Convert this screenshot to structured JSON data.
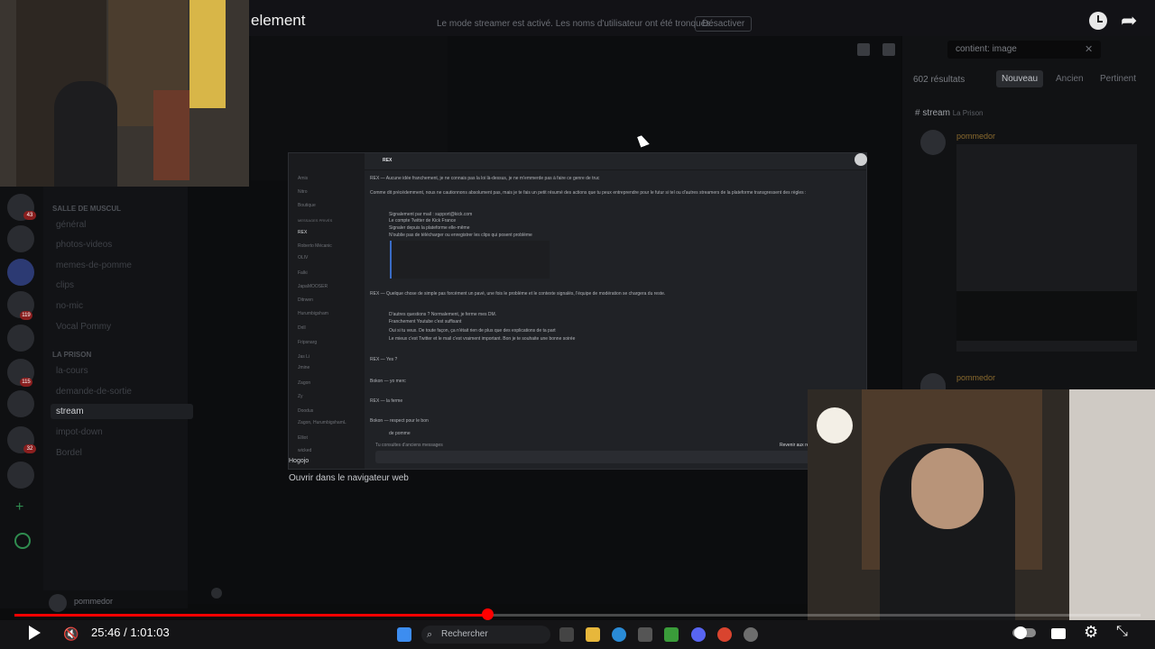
{
  "video": {
    "title": "element",
    "streamer_notice": "Le mode streamer est activé. Les noms d'utilisateur ont été tronqués.",
    "disable_label": "Désactiver",
    "current_time": "25:46",
    "duration": "1:01:03",
    "progress": 0.42,
    "time_display": "25:46 / 1:01:03",
    "autoplay_on": true
  },
  "discord": {
    "category_1": "SALLE DE MUSCUL",
    "channels_1": [
      "général",
      "photos-videos",
      "memes-de-pomme",
      "clips",
      "no-mic",
      "Vocal Pommy"
    ],
    "category_2": "LA PRISON",
    "channels_2": [
      "la-cours",
      "demande-de-sortie",
      "stream",
      "impot-down",
      "Bordel"
    ],
    "active_channel": "stream",
    "user": "pommedor",
    "guild_badges": [
      "43",
      "119",
      "115",
      "32"
    ]
  },
  "search": {
    "query": "contient: image",
    "results": "602 résultats",
    "sort_new": "Nouveau",
    "sort_old": "Ancien",
    "sort_relevant": "Pertinent",
    "channel": "stream",
    "channel_sub": "La Prison",
    "author": "pommedor"
  },
  "overlay": {
    "open_web": "Ouvrir dans le navigateur web",
    "username": "Hogojo",
    "header_name": "REX",
    "dms": [
      "Amis",
      "Nitro",
      "Boutique"
    ],
    "dm_section": "MESSAGES PRIVÉS",
    "dm_users": [
      "REX",
      "Roberto Mécanic",
      "OLIV",
      "Falki",
      "JapaMOOSER",
      "Ditrwen",
      "Hurumbigsham",
      "Drill",
      "Fripsnarg",
      "Jas Li",
      "Jmine",
      "Zagon",
      "Zy",
      "Doodus",
      "Zagon, HurumbigshamL",
      "Elliot",
      "wicked"
    ],
    "messages": [
      "REX — Aucune idée franchement, je ne connais pas la loi là-dessus, je ne m'emmerde pas à faire ce genre de truc",
      "Comme dit précédemment, nous ne cautionnons absolument pas, mais je te fais un petit résumé des actions que tu peux entreprendre pour le futur si tel ou d'autres streamers de la plateforme transgressent des règles :",
      "Signalement par mail : support@kick.com",
      "Le compte Twitter de Kick France",
      "Signaler depuis la plateforme elle-même",
      "N'oublie pas de télécharger ou enregistrer les clips qui posent problème",
      "REX — Quelque chose de simple pas forcément un pavé, une fois le problème et le contexte signalés, l'équipe de modération se chargera du reste.",
      "D'autres questions ? Normalement, je ferme mes DM.",
      "Franchement Youtube c'est suffisant",
      "Oui si tu veux. De toute façon, ça n'était rien de plus que des explications de ta part",
      "Le mieux c'est Twitter et le mail c'est vraiment important. Bon je te souhaite une bonne soirée",
      "REX — Yes ?",
      "Bokon — yo merc",
      "REX — la ferme",
      "Bokon — respect pour le bon",
      "de pomme"
    ],
    "old_messages_note": "Tu consultes d'anciens messages",
    "recent_label": "Revenir aux récents"
  },
  "taskbar": {
    "search_label": "Rechercher"
  }
}
